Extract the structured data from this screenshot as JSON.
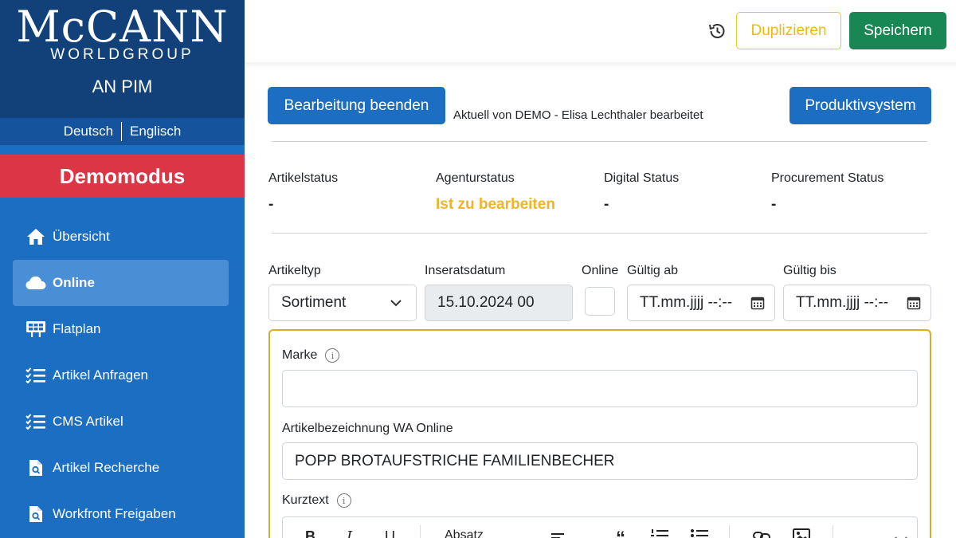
{
  "brand": {
    "logo_main": "McCANN",
    "logo_sub": "WORLDGROUP",
    "app_name": "AN PIM"
  },
  "languages": [
    "Deutsch",
    "Englisch"
  ],
  "demo_banner": "Demomodus",
  "sidebar": {
    "items": [
      {
        "label": "Übersicht",
        "icon": "home-icon",
        "active": false
      },
      {
        "label": "Online",
        "icon": "cloud-icon",
        "active": true
      },
      {
        "label": "Flatplan",
        "icon": "board-icon",
        "active": false
      },
      {
        "label": "Artikel Anfragen",
        "icon": "checklist-icon",
        "active": false
      },
      {
        "label": "CMS Artikel",
        "icon": "checklist-icon",
        "active": false
      },
      {
        "label": "Artikel Recherche",
        "icon": "file-search-icon",
        "active": false
      },
      {
        "label": "Workfront Freigaben",
        "icon": "file-search-icon",
        "active": false
      }
    ]
  },
  "topbar": {
    "history_icon": "history-icon",
    "duplicate_label": "Duplizieren",
    "save_label": "Speichern"
  },
  "main": {
    "end_edit_label": "Bearbeitung beenden",
    "edit_note": "Aktuell von DEMO - Elisa Lechthaler bearbeitet",
    "prod_label": "Produktivsystem",
    "statuses": [
      {
        "label": "Artikelstatus",
        "value": "-"
      },
      {
        "label": "Agenturstatus",
        "value": "Ist zu bearbeiten"
      },
      {
        "label": "Digital Status",
        "value": "-"
      },
      {
        "label": "Procurement Status",
        "value": "-"
      }
    ],
    "fields": {
      "artikeltyp": {
        "label": "Artikeltyp",
        "value": "Sortiment"
      },
      "inseratsdatum": {
        "label": "Inseratsdatum",
        "value": "15.10.2024 00"
      },
      "online": {
        "label": "Online",
        "checked": false
      },
      "gueltig_ab": {
        "label": "Gültig ab",
        "placeholder": "TT.mm.jjjj --:--"
      },
      "gueltig_bis": {
        "label": "Gültig bis",
        "placeholder": "TT.mm.jjjj --:--"
      }
    },
    "panel": {
      "marke": {
        "label": "Marke",
        "value": ""
      },
      "artikelbezeichnung": {
        "label": "Artikelbezeichnung WA Online",
        "value": "POPP BROTAUFSTRICHE FAMILIENBECHER"
      },
      "kurztext": {
        "label": "Kurztext"
      },
      "toolbar": {
        "bold": "B",
        "italic": "I",
        "underline": "U",
        "paragraph": "Absatz"
      }
    }
  },
  "colors": {
    "sidebar": "#1b6ec2",
    "brand": "#12417a",
    "demo": "#dc3545",
    "save": "#198754",
    "duplicate": "#f0b90b",
    "panel_border": "#d9ad25"
  }
}
